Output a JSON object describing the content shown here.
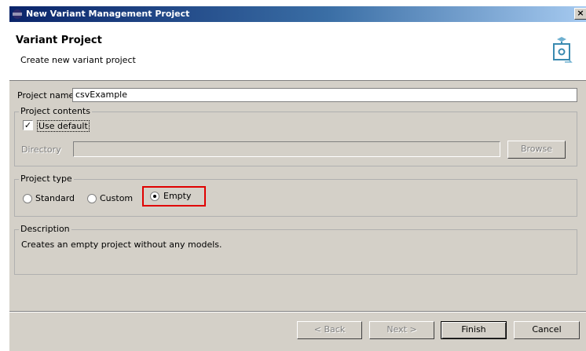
{
  "window": {
    "title": "New Variant Management Project",
    "close_symbol": "×"
  },
  "banner": {
    "title": "Variant Project",
    "description": "Create new variant project",
    "icon": "variant-project-wizard-icon"
  },
  "project_name": {
    "label": "Project name",
    "value": "csvExample"
  },
  "project_contents": {
    "legend": "Project contents",
    "use_default_label": "Use default",
    "use_default_checked": true,
    "directory_label": "Directory",
    "directory_value": "",
    "browse_label": "Browse"
  },
  "project_type": {
    "legend": "Project type",
    "options": [
      {
        "label": "Standard",
        "checked": false
      },
      {
        "label": "Custom",
        "checked": false
      },
      {
        "label": "Empty",
        "checked": true
      }
    ],
    "highlight_color": "#e00000"
  },
  "description_group": {
    "legend": "Description",
    "text": "Creates an empty project without any models."
  },
  "buttons": {
    "back": "< Back",
    "next": "Next >",
    "finish": "Finish",
    "cancel": "Cancel"
  },
  "colors": {
    "titlebar_start": "#0a246a",
    "titlebar_end": "#a6caf0",
    "dialog_bg": "#d4d0c8"
  }
}
